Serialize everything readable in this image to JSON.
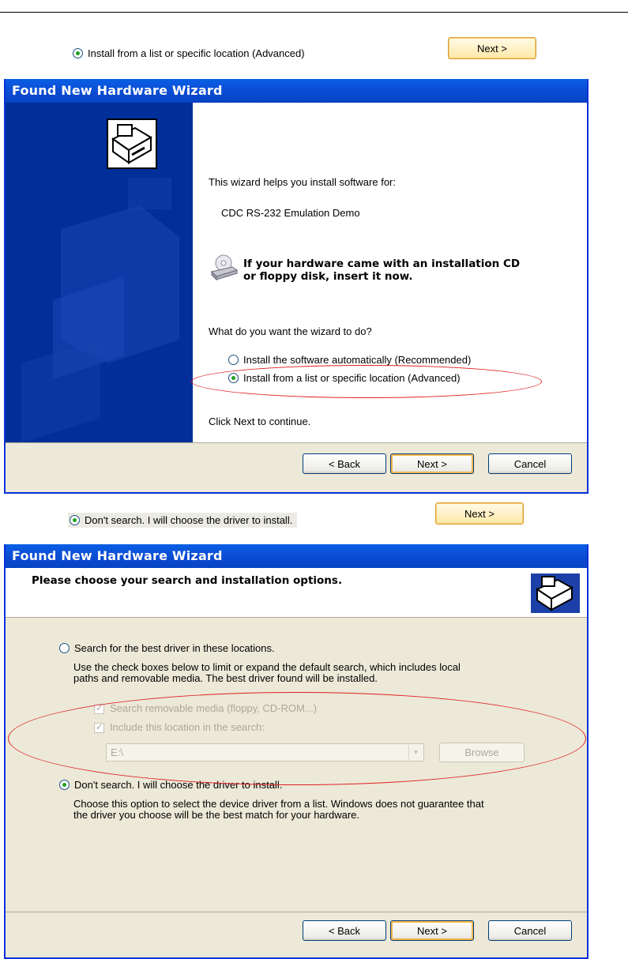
{
  "hint1": {
    "option": "Install from a list or specific location (Advanced)",
    "next_button": "Next >"
  },
  "wizard1": {
    "title": "Found New Hardware Wizard",
    "intro": "This wizard helps you install software for:",
    "device": "CDC RS-232 Emulation Demo",
    "cd_prompt_line1": "If your hardware came with an installation CD",
    "cd_prompt_line2": "or floppy disk, insert it now.",
    "question": "What do you want the wizard to do?",
    "options": [
      {
        "label": "Install the software automatically (Recommended)",
        "selected": false
      },
      {
        "label": "Install from a list or specific location (Advanced)",
        "selected": true
      }
    ],
    "continue_text": "Click Next to continue.",
    "buttons": {
      "back": "< Back",
      "next": "Next >",
      "cancel": "Cancel"
    }
  },
  "hint2": {
    "option": "Don't search. I will choose the driver to install.",
    "next_button": "Next >"
  },
  "wizard2": {
    "title": "Found New Hardware Wizard",
    "heading": "Please choose your search and installation options.",
    "search_option": "Search for the best driver in these locations.",
    "search_desc_line1": "Use the check boxes below to limit or expand the default search, which includes local",
    "search_desc_line2": "paths and removable media. The best driver found will be installed.",
    "checkbox_removable": "Search removable media (floppy, CD-ROM...)",
    "checkbox_location": "Include this location in the search:",
    "location_value": "E:\\",
    "browse_button": "Browse",
    "dont_search_option": "Don't search. I will choose the driver to install.",
    "dont_search_desc_line1": "Choose this option to select the device driver from a list.  Windows does not guarantee that",
    "dont_search_desc_line2": "the driver you choose will be the best match for your hardware.",
    "buttons": {
      "back": "< Back",
      "next": "Next >",
      "cancel": "Cancel"
    }
  },
  "colors": {
    "title_bar": "#0b4ed5",
    "sidebar": "#002f99",
    "highlight_ellipse": "#e02020",
    "radio_dot": "#21a121"
  },
  "icons": [
    "hardware-card-icon",
    "cd-drive-icon"
  ]
}
